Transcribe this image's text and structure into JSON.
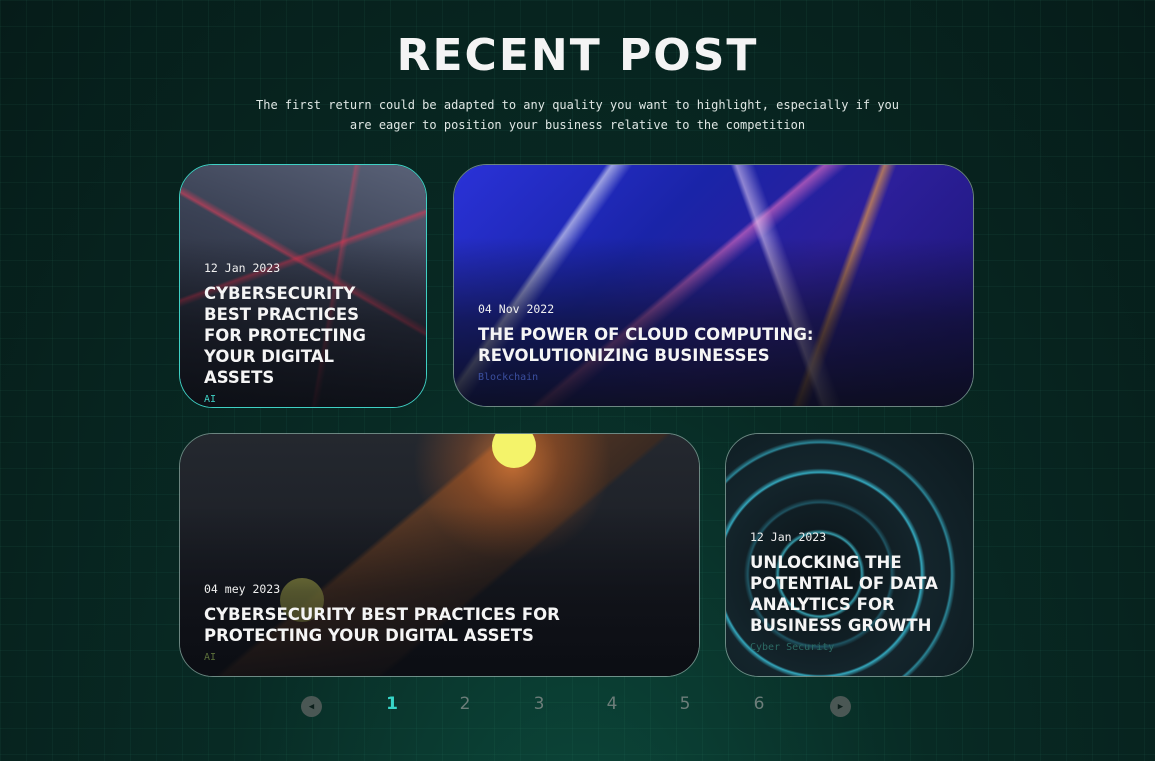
{
  "header": {
    "title": "RECENT POST",
    "subtitle": "The first return could be adapted to any quality you want to highlight, especially if you are eager to position your business relative to the competition"
  },
  "posts": [
    {
      "date": "12 Jan 2023",
      "title": "CYBERSECURITY BEST PRACTICES FOR PROTECTING YOUR DIGITAL ASSETS",
      "tag": "AI",
      "tag_color": "#3fd0c4"
    },
    {
      "date": "04 Nov 2022",
      "title": "THE POWER OF CLOUD COMPUTING: REVOLUTIONIZING BUSINESSES",
      "tag": "Blockchain",
      "tag_color": "#3b4fa0"
    },
    {
      "date": "04 mey 2023",
      "title": "CYBERSECURITY BEST PRACTICES FOR PROTECTING YOUR DIGITAL ASSETS",
      "tag": "AI",
      "tag_color": "#5b6f3a"
    },
    {
      "date": "12 Jan 2023",
      "title": "UNLOCKING THE POTENTIAL OF DATA ANALYTICS FOR BUSINESS GROWTH",
      "tag": "Cyber Security",
      "tag_color": "#2c6a64"
    }
  ],
  "pagination": {
    "pages": [
      "1",
      "2",
      "3",
      "4",
      "5",
      "6"
    ],
    "current": "1",
    "prev_icon": "chevron-left-icon",
    "next_icon": "chevron-right-icon"
  },
  "colors": {
    "accent": "#37d6c8",
    "background": "#082a24"
  }
}
